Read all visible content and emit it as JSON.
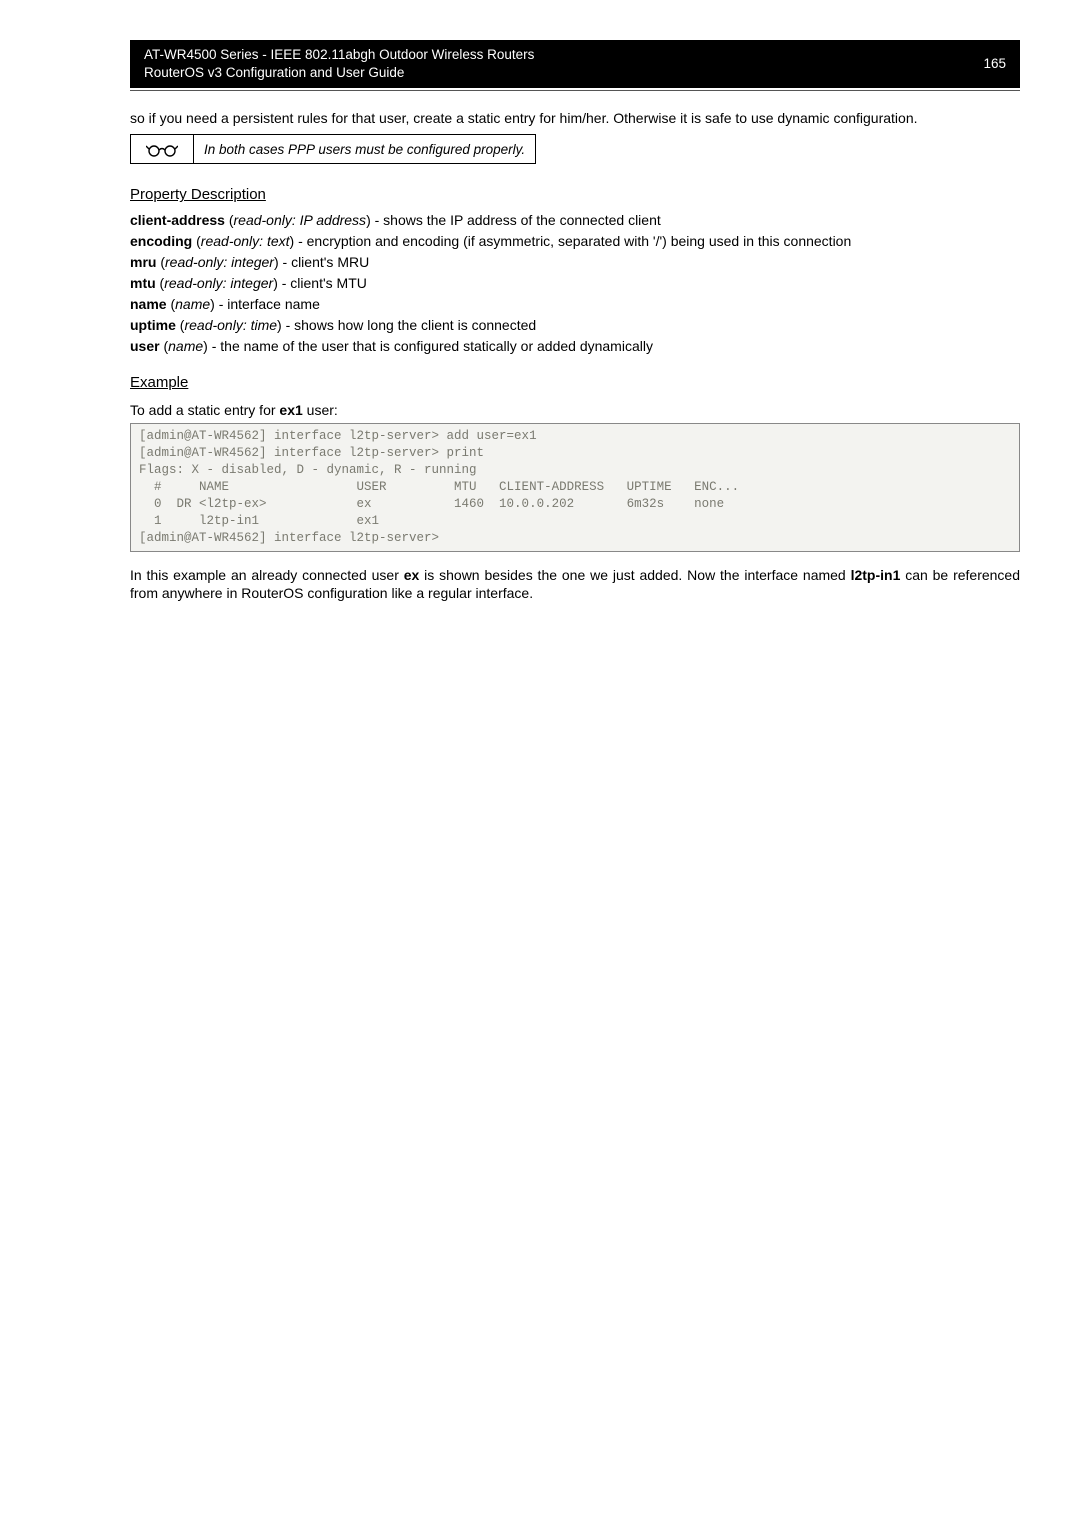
{
  "header": {
    "line1": "AT-WR4500 Series - IEEE 802.11abgh Outdoor Wireless Routers",
    "line2": "RouterOS v3 Configuration and User Guide",
    "page_number": "165"
  },
  "intro_paragraph": "so if you need a persistent rules for that user, create a static entry for him/her. Otherwise it is safe to use dynamic configuration.",
  "note_text": "In both cases PPP users must be configured properly.",
  "section_property": "Property Description",
  "props": {
    "p1a": "client-address",
    "p1b": "read-only: IP address",
    "p1c": ") - shows the IP address of the connected client",
    "p2a": "encoding",
    "p2b": "read-only: text",
    "p2c": ") - encryption and encoding (if asymmetric, separated with '/') being used in this connection",
    "p3a": "mru",
    "p3b": "read-only: integer",
    "p3c": ") - client's MRU",
    "p4a": "mtu",
    "p4b": "read-only: integer",
    "p4c": ") - client's MTU",
    "p5a": "name",
    "p5b": "name",
    "p5c": ") - interface name",
    "p6a": "uptime",
    "p6b": "read-only: time",
    "p6c": ") - shows how long the client is connected",
    "p7a": "user",
    "p7b": "name",
    "p7c": ") - the name of the user that is configured statically or added dynamically"
  },
  "section_example": "Example",
  "example_intro_a": "To add a static entry for ",
  "example_intro_b": "ex1",
  "example_intro_c": " user:",
  "code": "[admin@AT-WR4562] interface l2tp-server> add user=ex1\n[admin@AT-WR4562] interface l2tp-server> print\nFlags: X - disabled, D - dynamic, R - running\n  #     NAME                 USER         MTU   CLIENT-ADDRESS   UPTIME   ENC...\n  0  DR <l2tp-ex>            ex           1460  10.0.0.202       6m32s    none\n  1     l2tp-in1             ex1\n[admin@AT-WR4562] interface l2tp-server>",
  "after_code_a": "In this example an already connected user ",
  "after_code_b": "ex",
  "after_code_c": " is shown besides the one we just added. Now the interface named ",
  "after_code_d": "l2tp-in1",
  "after_code_e": " can be referenced from anywhere in RouterOS configuration like a regular interface."
}
